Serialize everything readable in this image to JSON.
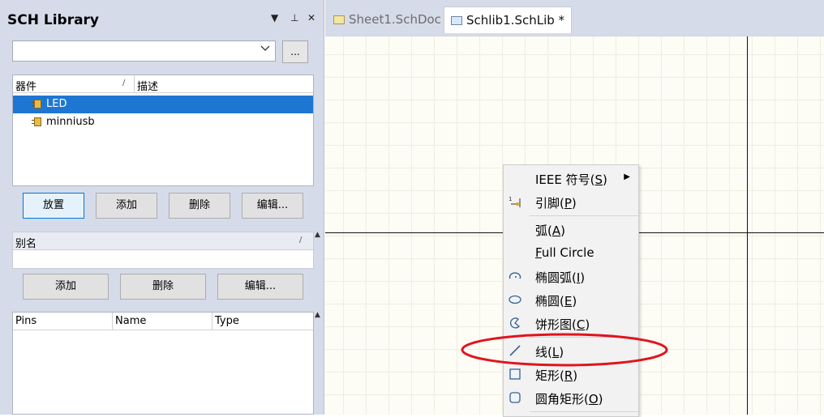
{
  "panel": {
    "title": "SCH Library",
    "header_buttons": [
      "▼",
      "⊥",
      "✕"
    ],
    "combo_value": "",
    "browse_button": "...",
    "component_list": {
      "col_component": "器件",
      "col_description": "描述",
      "sort_mark": "/",
      "rows": [
        {
          "name": "LED",
          "selected": true
        },
        {
          "name": "minniusb",
          "selected": false
        }
      ]
    },
    "buttons1": [
      "放置",
      "添加",
      "删除",
      "编辑..."
    ],
    "alias": {
      "header": "别名",
      "sort_mark": "/"
    },
    "buttons2": [
      "添加",
      "删除",
      "编辑..."
    ],
    "pins": {
      "col_pins": "Pins",
      "col_name": "Name",
      "col_type": "Type"
    }
  },
  "tabs": [
    {
      "label": "Sheet1.SchDoc *",
      "active": false,
      "icon": "schdoc-icon"
    },
    {
      "label": "Schlib1.SchLib *",
      "active": true,
      "icon": "schlib-icon"
    }
  ],
  "menu": {
    "items": [
      {
        "label": "IEEE 符号(",
        "mn": "S",
        "end": ")",
        "icon": "",
        "submenu": true
      },
      {
        "label": "引脚(",
        "mn": "P",
        "end": ")",
        "icon": "pin-icon"
      },
      {
        "label": "弧(",
        "mn": "A",
        "end": ")",
        "icon": ""
      },
      {
        "label": "",
        "mn": "F",
        "end": "ull Circle",
        "icon": ""
      },
      {
        "label": "椭圆弧(",
        "mn": "I",
        "end": ")",
        "icon": "elliptical-arc-icon"
      },
      {
        "label": "椭圆(",
        "mn": "E",
        "end": ")",
        "icon": "ellipse-icon"
      },
      {
        "label": "饼形图(",
        "mn": "C",
        "end": ")",
        "icon": "pie-icon"
      },
      {
        "label": "线(",
        "mn": "L",
        "end": ")",
        "icon": "line-icon"
      },
      {
        "label": "矩形(",
        "mn": "R",
        "end": ")",
        "icon": "rectangle-icon"
      },
      {
        "label": "圆角矩形(",
        "mn": "O",
        "end": ")",
        "icon": "round-rectangle-icon"
      }
    ]
  },
  "colors": {
    "selection": "#1e76d3",
    "annotation": "#e0141c"
  }
}
